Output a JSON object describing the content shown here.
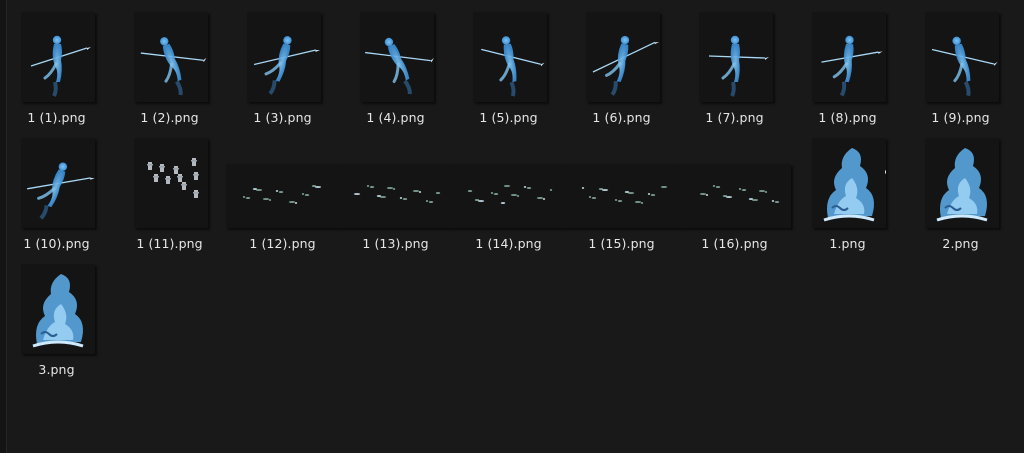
{
  "files": [
    {
      "name": "1 (1).png",
      "thumb": "spear-figure-1",
      "kind": "sprite"
    },
    {
      "name": "1 (2).png",
      "thumb": "spear-figure-2",
      "kind": "sprite"
    },
    {
      "name": "1 (3).png",
      "thumb": "spear-figure-3",
      "kind": "sprite"
    },
    {
      "name": "1 (4).png",
      "thumb": "spear-figure-4",
      "kind": "sprite"
    },
    {
      "name": "1 (5).png",
      "thumb": "spear-figure-5",
      "kind": "sprite"
    },
    {
      "name": "1 (6).png",
      "thumb": "spear-figure-6",
      "kind": "sprite"
    },
    {
      "name": "1 (7).png",
      "thumb": "spear-figure-7",
      "kind": "sprite"
    },
    {
      "name": "1 (8).png",
      "thumb": "spear-figure-8",
      "kind": "sprite"
    },
    {
      "name": "1 (9).png",
      "thumb": "spear-figure-9",
      "kind": "sprite"
    },
    {
      "name": "1 (10).png",
      "thumb": "spear-figure-10",
      "kind": "sprite"
    },
    {
      "name": "1 (11).png",
      "thumb": "rune-glyphs",
      "kind": "glyphs"
    },
    {
      "name": "1 (12).png",
      "thumb": "particle-strip-12",
      "kind": "particles"
    },
    {
      "name": "1 (13).png",
      "thumb": "particle-strip-13",
      "kind": "particles"
    },
    {
      "name": "1 (14).png",
      "thumb": "particle-strip-14",
      "kind": "particles"
    },
    {
      "name": "1 (15).png",
      "thumb": "particle-strip-15",
      "kind": "particles"
    },
    {
      "name": "1 (16).png",
      "thumb": "particle-strip-16",
      "kind": "particles"
    },
    {
      "name": "1.png",
      "thumb": "water-spirit-1",
      "kind": "water"
    },
    {
      "name": "2.png",
      "thumb": "water-spirit-2",
      "kind": "water"
    },
    {
      "name": "3.png",
      "thumb": "water-spirit-3",
      "kind": "water"
    }
  ],
  "colors": {
    "background": "#191919",
    "sprite": "#7fc4f0",
    "sprite_glow": "#3d8fd6",
    "label": "#e6e6e6"
  }
}
